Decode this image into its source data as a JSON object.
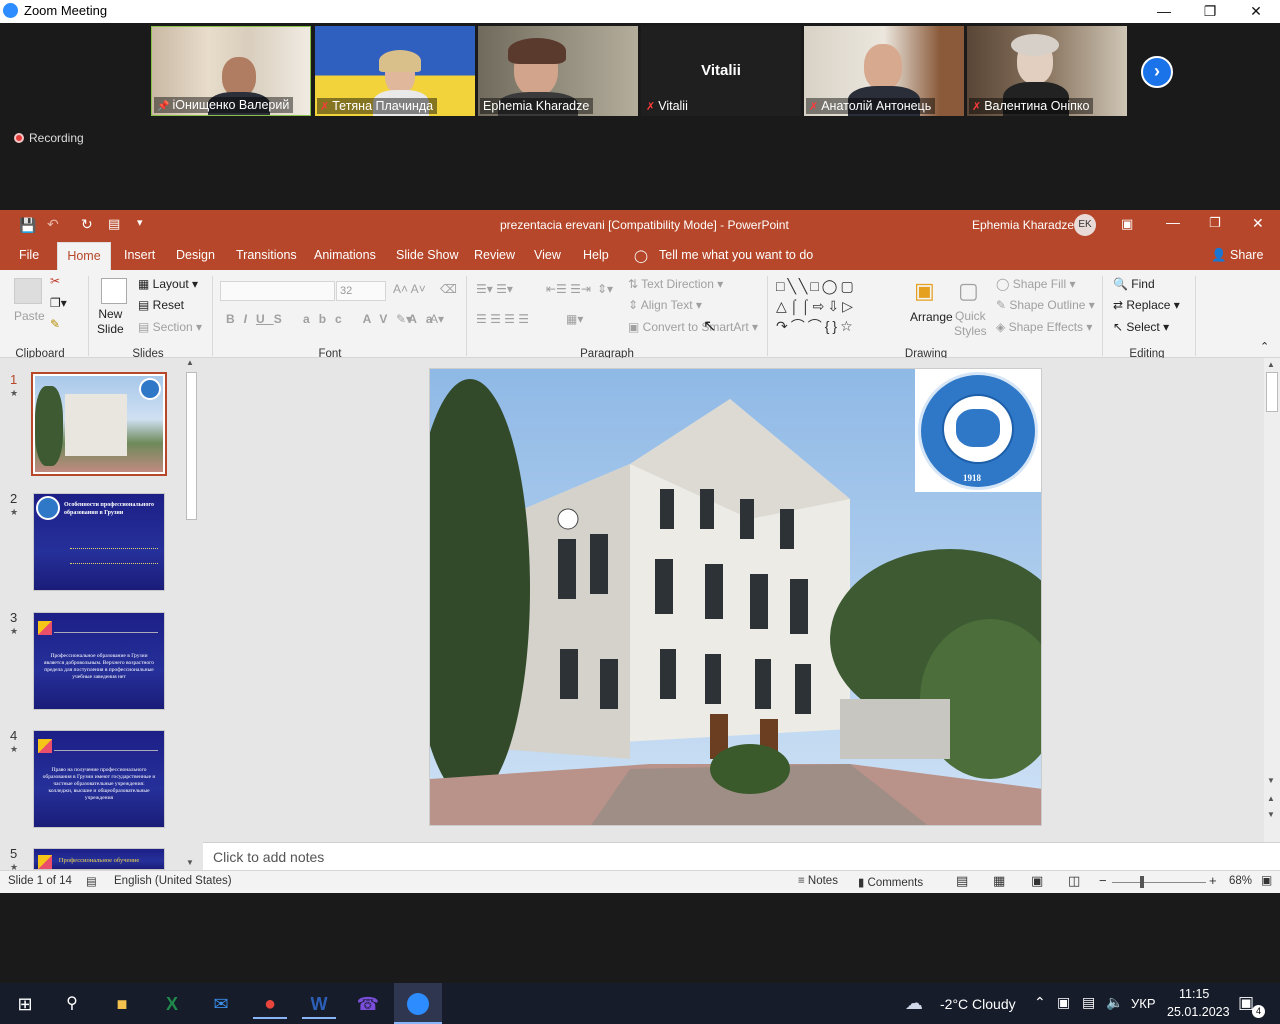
{
  "zoom": {
    "title": "Zoom Meeting",
    "recording": "Recording",
    "participants": [
      {
        "name": "іОнищенко Валерий",
        "muted": false,
        "pinned": true
      },
      {
        "name": "Тетяна Плачинда",
        "muted": true
      },
      {
        "name": "Ephemia Kharadze",
        "muted": false
      },
      {
        "name": "Vitalii",
        "muted": true,
        "video_off_label": "Vitalii"
      },
      {
        "name": "Анатолій Антонець",
        "muted": true
      },
      {
        "name": "Валентина Онiпко",
        "muted": true
      }
    ]
  },
  "powerpoint": {
    "title": "prezentacia erevani [Compatibility Mode]  -  PowerPoint",
    "user": "Ephemia Kharadze",
    "initials": "EK",
    "tabs": [
      "File",
      "Home",
      "Insert",
      "Design",
      "Transitions",
      "Animations",
      "Slide Show",
      "Review",
      "View",
      "Help"
    ],
    "tell_me": "Tell me what you want to do",
    "share": "Share",
    "ribbon": {
      "paste": "Paste",
      "new_slide": "New\nSlide",
      "layout": "Layout",
      "reset": "Reset",
      "section": "Section",
      "font_size": "32",
      "text_direction": "Text Direction",
      "align_text": "Align Text",
      "convert_smartart": "Convert to SmartArt",
      "arrange": "Arrange",
      "quick_styles": "Quick\nStyles",
      "shape_fill": "Shape Fill",
      "shape_outline": "Shape Outline",
      "shape_effects": "Shape Effects",
      "find": "Find",
      "replace": "Replace",
      "select": "Select",
      "groups": [
        "Clipboard",
        "Slides",
        "Font",
        "Paragraph",
        "Drawing",
        "Editing"
      ]
    },
    "thumbnails": [
      {
        "num": "1",
        "text": ""
      },
      {
        "num": "2",
        "text": "Особенности профессионального образования в Грузии"
      },
      {
        "num": "3",
        "text": "Профессиональное образование в Грузии является добровольным. Верхнего возрастного предела для поступления в профессиональные учебные заведения нет"
      },
      {
        "num": "4",
        "text": "Право на получение профессионального образования в Грузии имеют государственные и частные образовательные учреждения: колледжи, высшие и общеобразовательные учреждения"
      },
      {
        "num": "5",
        "text": "Профессиональное обучение"
      }
    ],
    "seal": {
      "year": "1918",
      "text": "UNIVERSITAS TPHILISENSIS"
    },
    "notes_placeholder": "Click to add notes",
    "status": {
      "slide": "Slide 1 of 14",
      "language": "English (United States)",
      "notes": "Notes",
      "comments": "Comments",
      "zoom": "68%"
    }
  },
  "taskbar": {
    "weather": "-2°C  Cloudy",
    "lang": "УКР",
    "time": "11:15",
    "date": "25.01.2023",
    "notif_count": "4"
  }
}
